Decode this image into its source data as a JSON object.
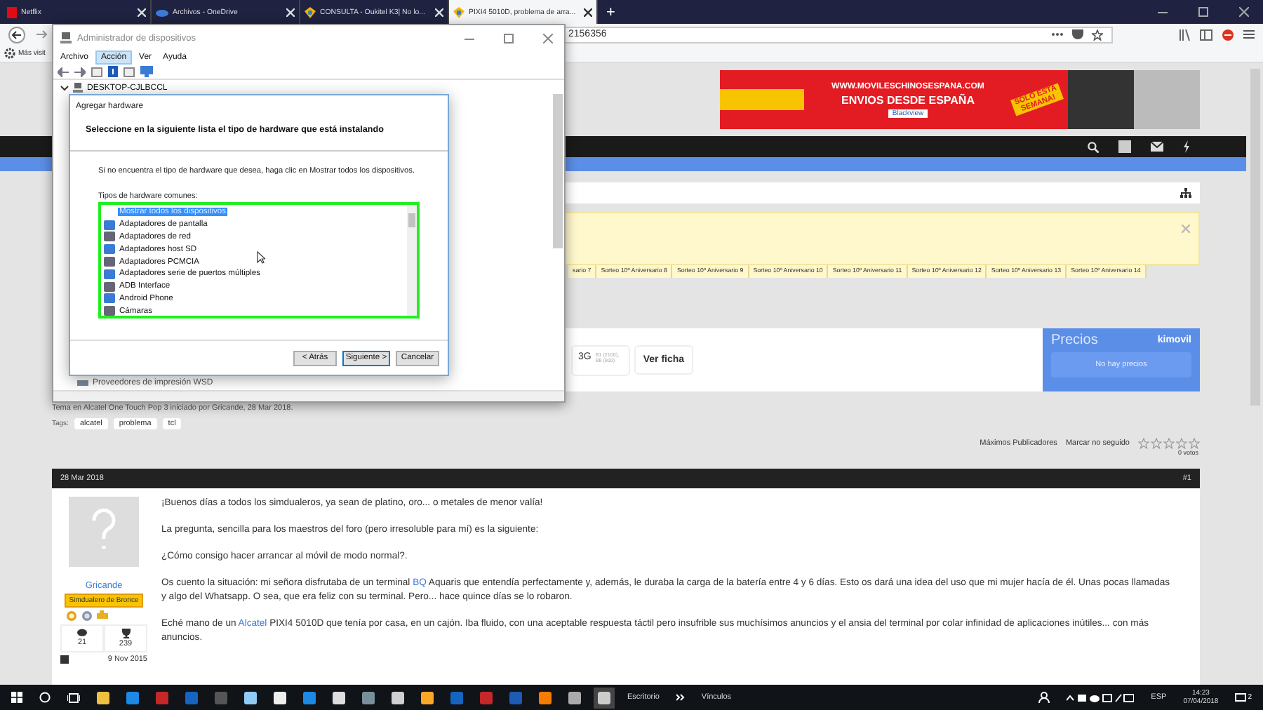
{
  "browser": {
    "tabs": [
      {
        "title": "Netflix",
        "selected": false
      },
      {
        "title": "Archivos - OneDrive",
        "selected": false
      },
      {
        "title": "CONSULTA - Oukitel K3| No lo...",
        "selected": false
      },
      {
        "title": "PIXI4 5010D, problema de arra...",
        "selected": true
      }
    ],
    "new_tab": "+",
    "url": "2156356",
    "bookmark": "Más visit"
  },
  "device_manager": {
    "title": "Administrador de dispositivos",
    "menu": [
      {
        "label": "Archivo",
        "selected": false
      },
      {
        "label": "Acción",
        "selected": true
      },
      {
        "label": "Ver",
        "selected": false
      },
      {
        "label": "Ayuda",
        "selected": false
      }
    ],
    "computer": "DESKTOP-CJLBCCL",
    "last_item": "Proveedores de impresión WSD"
  },
  "dialog": {
    "title": "Agregar hardware",
    "heading": "Seleccione en la siguiente lista el tipo de hardware que está instalando",
    "instruction": "Si no encuentra el tipo de hardware que desea, haga clic en Mostrar todos los dispositivos.",
    "list_label": "Tipos de hardware comunes:",
    "items": [
      {
        "label": "Mostrar todos los dispositivos",
        "selected": true
      },
      {
        "label": "Adaptadores de pantalla",
        "selected": false
      },
      {
        "label": "Adaptadores de red",
        "selected": false
      },
      {
        "label": "Adaptadores host SD",
        "selected": false
      },
      {
        "label": "Adaptadores PCMCIA",
        "selected": false
      },
      {
        "label": "Adaptadores serie de puertos múltiples",
        "selected": false
      },
      {
        "label": "ADB Interface",
        "selected": false
      },
      {
        "label": "Android Phone",
        "selected": false
      },
      {
        "label": "Cámaras",
        "selected": false
      }
    ],
    "buttons": [
      {
        "label": "< Atrás",
        "default": false
      },
      {
        "label": "Siguiente >",
        "default": true
      },
      {
        "label": "Cancelar",
        "default": false
      }
    ]
  },
  "site": {
    "ad": {
      "site": "WWW.MOVILESCHINOSESPANA.COM",
      "headline": "ENVIOS DESDE ESPAÑA",
      "promo": "SOLO ESTA SEMANA!",
      "brand": "Blackview"
    },
    "raffle_tabs": [
      "sario 7",
      "Sorteo 10º Aniversario 8",
      "Sorteo 10º Aniversario 9",
      "Sorteo 10º Aniversario 10",
      "Sorteo 10º Aniversario 11",
      "Sorteo 10º Aniversario 12",
      "Sorteo 10º Aniversario 13",
      "Sorteo 10º Aniversario 14"
    ],
    "product": {
      "network": "3G",
      "bands": "B1 (2100), B8 (900)",
      "details_link": "Ver ficha",
      "prices_title": "Precios",
      "prices_brand": "kimovil",
      "prices_empty": "No hay precios"
    },
    "thread_info": "Tema en Alcatel One Touch Pop 3 iniciado por Gricande, 28 Mar 2018.",
    "tags_label": "Tags:",
    "tags": [
      "alcatel",
      "problema",
      "tcl"
    ],
    "thread_tools": [
      "Máximos Publicadores",
      "Marcar no seguido"
    ],
    "rating": {
      "stars": 0,
      "votes": "0 votos"
    },
    "post": {
      "date": "28 Mar 2018",
      "number": "#1",
      "author": "Gricande",
      "rank": "Simdualero de Bronce",
      "posts": "21",
      "trophies": "239",
      "joined": "9 Nov 2015",
      "paragraphs": [
        [
          {
            "kind": "text",
            "text": "¡Buenos días a todos los simdualeros, ya sean de platino, oro... o metales de menor valía!"
          }
        ],
        [
          {
            "kind": "text",
            "text": "La pregunta, sencilla para los maestros del foro (pero irresoluble para mí) es la siguiente:"
          }
        ],
        [
          {
            "kind": "text",
            "text": "¿Cómo consigo hacer arrancar al móvil de modo normal?."
          }
        ],
        [
          {
            "kind": "text",
            "text": "Os cuento la situación: mi señora disfrutaba de un terminal "
          },
          {
            "kind": "link",
            "text": "BQ"
          },
          {
            "kind": "text",
            "text": " Aquaris que entendía perfectamente y, además, le duraba la carga de la batería entre 4 y 6 días. Esto os dará una idea del uso que mi mujer hacía de él. Unas pocas llamadas y algo del Whatsapp. O sea, que era feliz con su terminal. Pero... hace quince días se lo robaron."
          }
        ],
        [
          {
            "kind": "text",
            "text": "Eché mano de un "
          },
          {
            "kind": "link",
            "text": "Alcatel"
          },
          {
            "kind": "text",
            "text": " PIXI4 5010D que tenía por casa, en un cajón. Iba fluido, con una aceptable respuesta táctil pero insufrible sus muchísimos anuncios y el ansia del terminal por colar infinidad de aplicaciones inútiles... con más anuncios."
          }
        ]
      ]
    }
  },
  "taskbar": {
    "toolbars": [
      "Escritorio",
      "Vínculos"
    ],
    "language": "ESP",
    "time": "14:23",
    "date": "07/04/2018",
    "notifications": "2"
  }
}
